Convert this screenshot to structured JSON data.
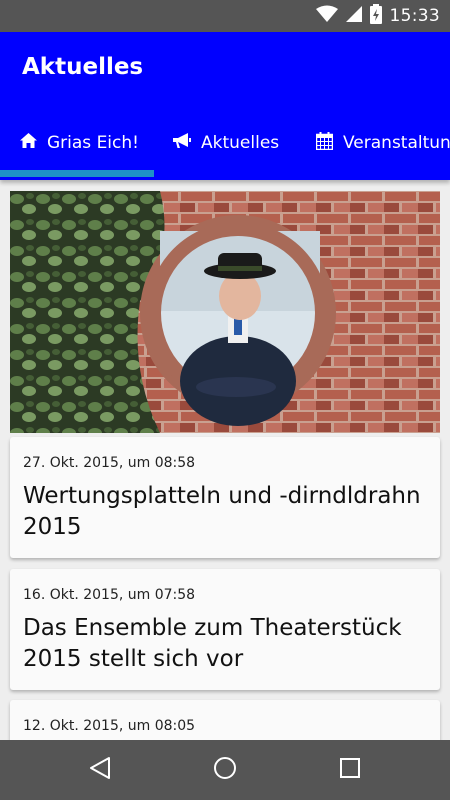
{
  "status_bar": {
    "time": "15:33",
    "icons": [
      "wifi-icon",
      "cell-signal-icon",
      "battery-charging-icon"
    ]
  },
  "app_bar": {
    "title": "Aktuelles",
    "background_color": "#0000ff",
    "indicator_color": "#1e90c8"
  },
  "tabs": [
    {
      "label": "Grias Eich!",
      "icon": "home-icon",
      "selected": true
    },
    {
      "label": "Aktuelles",
      "icon": "megaphone-icon",
      "selected": false
    },
    {
      "label": "Veranstaltungen",
      "icon": "calendar-icon",
      "selected": false
    }
  ],
  "hero": {
    "description_icon": "photo"
  },
  "news": [
    {
      "date": "27. Okt. 2015, um 08:58",
      "title": "Wertungsplatteln und -dirndldrahn 2015"
    },
    {
      "date": "16. Okt. 2015, um 07:58",
      "title": "Das Ensemble zum Theaterstück 2015 stellt sich vor"
    },
    {
      "date": "12. Okt. 2015, um 08:05",
      "title": ""
    }
  ],
  "nav_bar": {
    "buttons": [
      "back-icon",
      "home-circle-icon",
      "recents-icon"
    ]
  }
}
